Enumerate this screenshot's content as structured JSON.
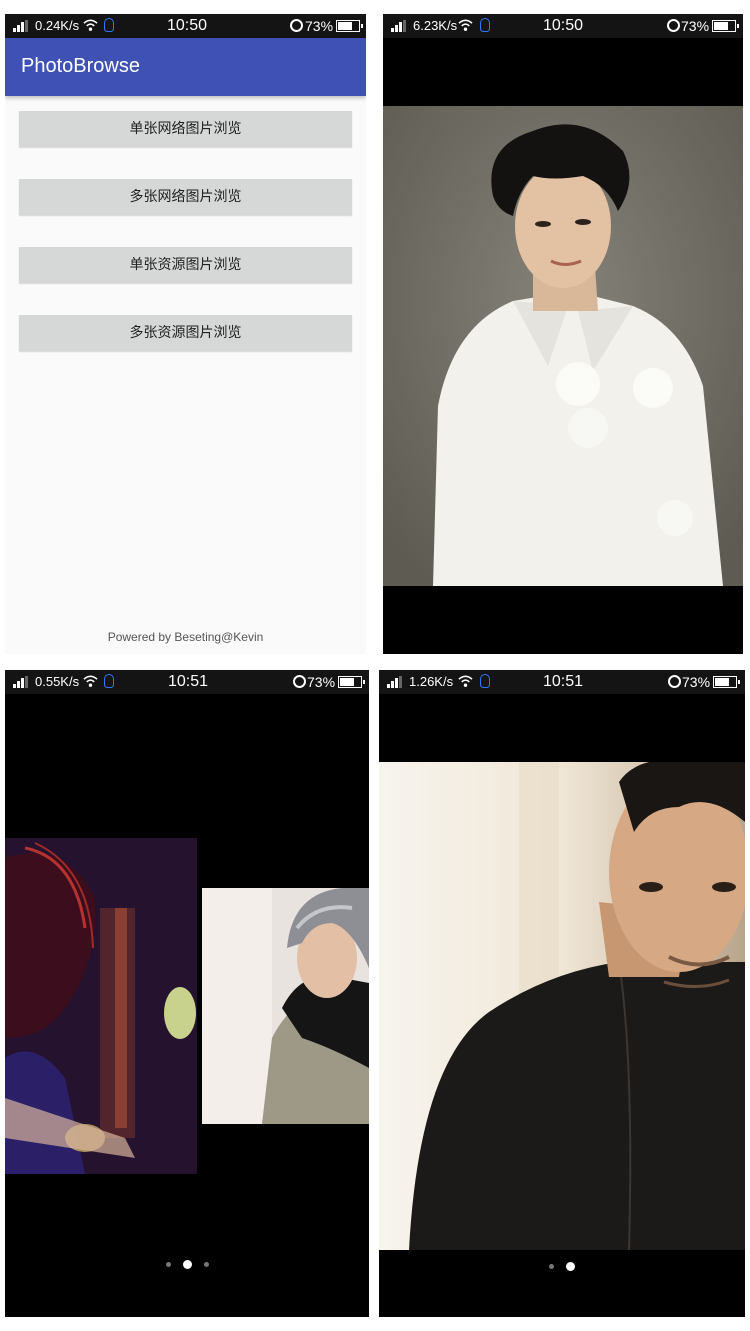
{
  "panel1": {
    "status": {
      "speed": "0.24K/s",
      "time": "10:50",
      "battery": "73%"
    },
    "app_title": "PhotoBrowse",
    "buttons": [
      "单张网络图片浏览",
      "多张网络图片浏览",
      "单张资源图片浏览",
      "多张资源图片浏览"
    ],
    "footer": "Powered by Beseting@Kevin"
  },
  "panel2": {
    "status": {
      "speed": "6.23K/s",
      "time": "10:50",
      "battery": "73%"
    }
  },
  "panel3": {
    "status": {
      "speed": "0.55K/s",
      "time": "10:51",
      "battery": "73%"
    },
    "pager": {
      "count": 3,
      "active_index": 1
    }
  },
  "panel4": {
    "status": {
      "speed": "1.26K/s",
      "time": "10:51",
      "battery": "73%"
    },
    "pager": {
      "count": 2,
      "active_index": 1
    }
  },
  "colors": {
    "appbar": "#3f51b5",
    "button": "#d6d7d7",
    "status_bar": "#141414",
    "qq_icon": "#2f7bff"
  },
  "icons": [
    "signal-icon",
    "wifi-icon",
    "qq-icon",
    "alarm-icon",
    "battery-icon"
  ]
}
